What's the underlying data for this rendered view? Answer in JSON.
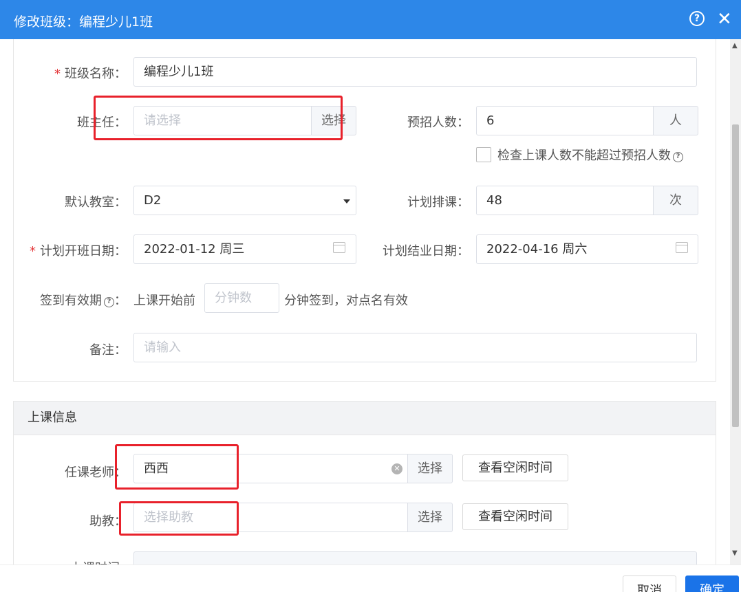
{
  "dialog": {
    "title": "修改班级：编程少儿1班",
    "help_icon": "question-circle-icon",
    "close_icon": "close-icon",
    "help_glyph": "?",
    "close_glyph": "✕"
  },
  "form": {
    "class_name": {
      "label": "班级名称：",
      "required_mark": "*",
      "value": "编程少儿1班"
    },
    "head_teacher": {
      "label": "班主任：",
      "placeholder": "请选择",
      "button": "选择"
    },
    "planned_students": {
      "label": "预招人数：",
      "value": "6",
      "unit": "人"
    },
    "check_limit": {
      "label": "检查上课人数不能超过预招人数",
      "checked": false,
      "help_glyph": "?"
    },
    "default_room": {
      "label": "默认教室：",
      "value": "D2"
    },
    "planned_lessons": {
      "label": "计划排课：",
      "value": "48",
      "unit": "次"
    },
    "start_date": {
      "label": "计划开班日期：",
      "required_mark": "*",
      "value": "2022-01-12 周三"
    },
    "end_date": {
      "label": "计划结业日期：",
      "value": "2022-04-16 周六"
    },
    "checkin": {
      "label": "签到有效期",
      "colon": "：",
      "help_glyph": "?",
      "prefix": "上课开始前",
      "placeholder": "分钟数",
      "suffix": "分钟签到，对点名有效"
    },
    "remark": {
      "label": "备注：",
      "placeholder": "请输入"
    }
  },
  "lesson_info": {
    "header": "上课信息",
    "teacher": {
      "label": "任课老师：",
      "value": "西西",
      "button": "选择",
      "free_time_button": "查看空闲时间",
      "clear_glyph": "✕"
    },
    "assistant": {
      "label": "助教：",
      "placeholder": "选择助教",
      "button": "选择",
      "free_time_button": "查看空闲时间"
    },
    "schedule": {
      "label": "上课时间"
    }
  },
  "footer": {
    "cancel": "取消",
    "confirm": "确定"
  },
  "colors": {
    "titlebar": "#2d87e8",
    "primary": "#1a73e8",
    "annotation": "#e8212b"
  }
}
